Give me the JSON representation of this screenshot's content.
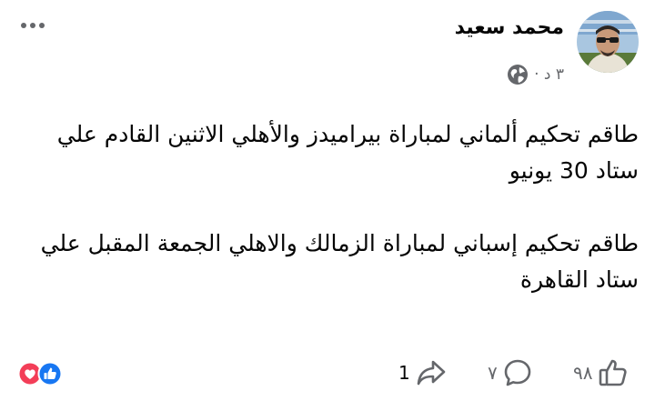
{
  "post": {
    "author": "محمد سعيد",
    "time": "٣ د ·",
    "paragraphs": [
      "طاقم تحكيم ألماني لمباراة بيراميدز والأهلي الاثنين القادم علي ستاد 30 يونيو",
      "طاقم تحكيم إسباني لمباراة الزمالك والاهلي الجمعة المقبل علي ستاد القاهرة"
    ]
  },
  "actions": {
    "shares": "1",
    "comments": "٧",
    "likes": "٩٨"
  },
  "icons": {
    "more": "more-options-icon",
    "privacy": "globe-icon",
    "reaction_like": "like-reaction-icon",
    "reaction_love": "love-reaction-icon",
    "share": "share-icon",
    "comment": "comment-icon",
    "like": "thumbs-up-icon"
  },
  "colors": {
    "like_blue": "#1877f2",
    "love_red": "#f33e58",
    "secondary_text": "#65676b"
  }
}
